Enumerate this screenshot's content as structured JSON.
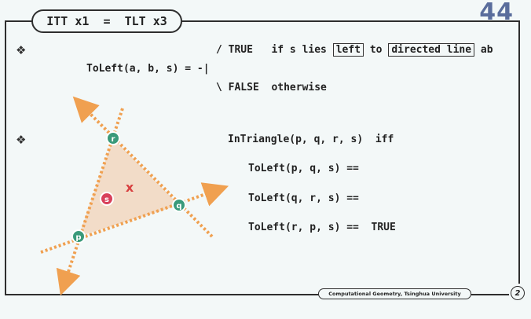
{
  "header": {
    "title": "ITT x1  =  TLT x3",
    "page_number": "44"
  },
  "toleft": {
    "bullet": "❖",
    "line1_prefix": "/ TRUE   if s lies ",
    "line1_box1": "left",
    "line1_to": " to ",
    "line1_box2": "directed line",
    "line1_suffix": " ab",
    "line2": "ToLeft(a, b, s) = -|",
    "line3": "\\ FALSE  otherwise"
  },
  "intriangle": {
    "bullet": "❖",
    "heading": "InTriangle(p, q, r, s)  iff",
    "cond1": "ToLeft(p, q, s) ==",
    "cond2": "ToLeft(q, r, s) ==",
    "cond3": "ToLeft(r, p, s) ==  TRUE"
  },
  "diagram": {
    "labels": {
      "p": "p",
      "q": "q",
      "r": "r",
      "s": "s",
      "x_mark": "x"
    },
    "colors": {
      "triangle_fill": "#f2dcc8",
      "dotted_line": "#f0a050",
      "vertex": "#3a9a7a",
      "query": "#d8405a",
      "cross": "#d84040"
    }
  },
  "footer": {
    "course": "Computational Geometry, Tsinghua University",
    "slide": "2"
  }
}
